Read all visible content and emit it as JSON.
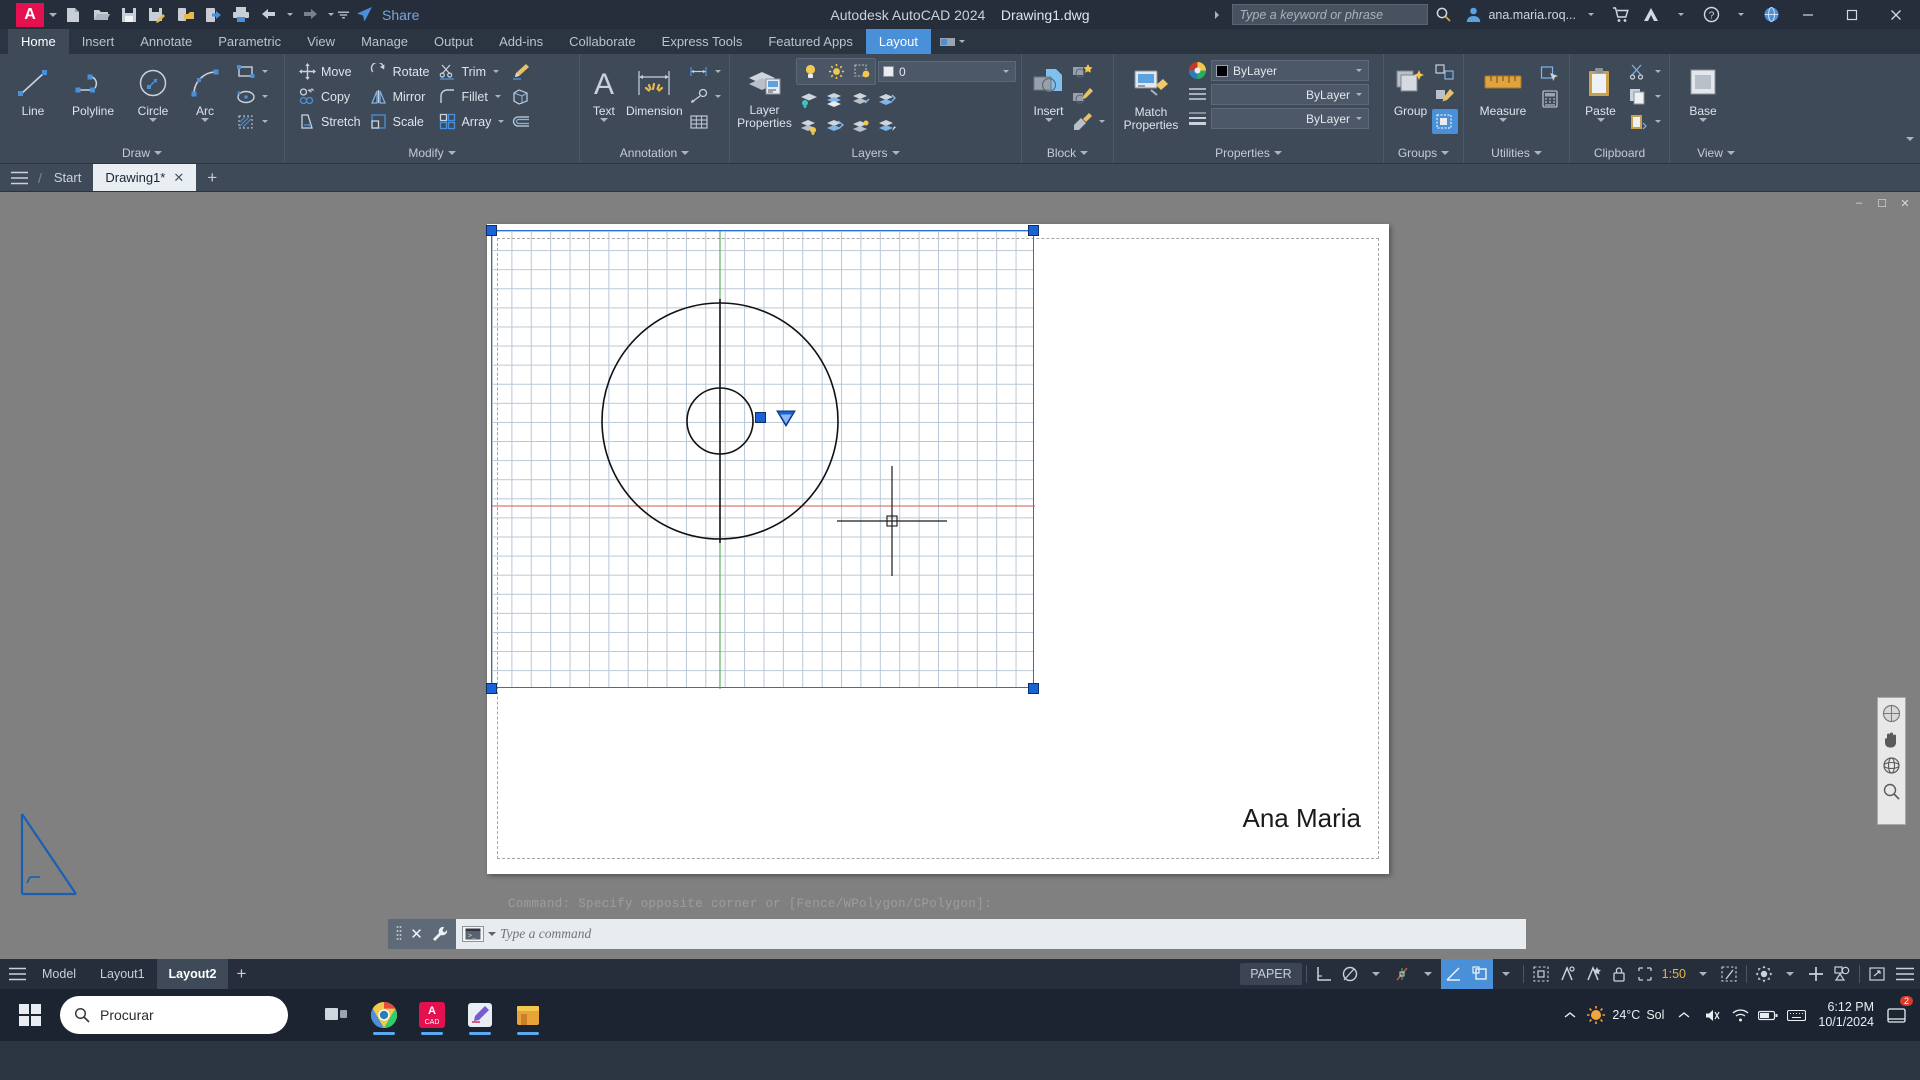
{
  "titlebar": {
    "app_logo": "A",
    "product": "Autodesk AutoCAD 2024",
    "filename": "Drawing1.dwg",
    "share_label": "Share",
    "search_placeholder": "Type a keyword or phrase",
    "user": "ana.maria.roq...",
    "qat": [
      {
        "name": "new-file-icon",
        "title": "New"
      },
      {
        "name": "open-file-icon",
        "title": "Open"
      },
      {
        "name": "save-icon",
        "title": "Save"
      },
      {
        "name": "save-as-icon",
        "title": "Save As"
      },
      {
        "name": "save-to-web-icon",
        "title": "Save to Web & Mobile"
      },
      {
        "name": "open-from-web-icon",
        "title": "Open from Web & Mobile"
      },
      {
        "name": "plot-icon",
        "title": "Plot"
      },
      {
        "name": "undo-icon",
        "title": "Undo"
      },
      {
        "name": "redo-icon",
        "title": "Redo"
      }
    ],
    "window_buttons": [
      "minimize",
      "maximize",
      "close"
    ]
  },
  "ribbon_tabs": [
    {
      "label": "Home",
      "state": "active"
    },
    {
      "label": "Insert",
      "state": "normal"
    },
    {
      "label": "Annotate",
      "state": "normal"
    },
    {
      "label": "Parametric",
      "state": "normal"
    },
    {
      "label": "View",
      "state": "normal"
    },
    {
      "label": "Manage",
      "state": "normal"
    },
    {
      "label": "Output",
      "state": "normal"
    },
    {
      "label": "Add-ins",
      "state": "normal"
    },
    {
      "label": "Collaborate",
      "state": "normal"
    },
    {
      "label": "Express Tools",
      "state": "normal"
    },
    {
      "label": "Featured Apps",
      "state": "normal"
    },
    {
      "label": "Layout",
      "state": "highlight"
    }
  ],
  "ribbon": {
    "draw": {
      "title": "Draw",
      "big": [
        {
          "label": "Line",
          "icon": "line-icon",
          "has_arrow": false
        },
        {
          "label": "Polyline",
          "icon": "polyline-icon",
          "has_arrow": false
        },
        {
          "label": "Circle",
          "icon": "circle-icon",
          "has_arrow": true
        },
        {
          "label": "Arc",
          "icon": "arc-icon",
          "has_arrow": true
        }
      ],
      "small": [
        {
          "icon": "rectangle-icon",
          "has_arrow": true
        },
        {
          "icon": "ellipse-icon",
          "has_arrow": true
        },
        {
          "icon": "hatch-icon",
          "has_arrow": true
        }
      ]
    },
    "modify": {
      "title": "Modify",
      "col1": [
        {
          "label": "Move",
          "icon": "move-icon"
        },
        {
          "label": "Copy",
          "icon": "copy-icon"
        },
        {
          "label": "Stretch",
          "icon": "stretch-icon"
        }
      ],
      "col2": [
        {
          "label": "Rotate",
          "icon": "rotate-icon"
        },
        {
          "label": "Mirror",
          "icon": "mirror-icon"
        },
        {
          "label": "Scale",
          "icon": "scale-icon"
        }
      ],
      "col3": [
        {
          "label": "Trim",
          "icon": "trim-icon",
          "has_arrow": true
        },
        {
          "label": "Fillet",
          "icon": "fillet-icon",
          "has_arrow": true
        },
        {
          "label": "Array",
          "icon": "array-icon",
          "has_arrow": true
        }
      ],
      "col4": [
        {
          "icon": "erase-icon"
        },
        {
          "icon": "extrude-icon"
        },
        {
          "icon": "offset-icon"
        }
      ]
    },
    "annotation": {
      "title": "Annotation",
      "big": [
        {
          "label": "Text",
          "icon": "text-icon",
          "has_arrow": true
        },
        {
          "label": "Dimension",
          "icon": "dimension-icon",
          "has_arrow": false
        }
      ],
      "small": [
        {
          "icon": "linear-dimension-icon",
          "has_arrow": true
        },
        {
          "icon": "leader-icon",
          "has_arrow": true
        },
        {
          "icon": "table-icon",
          "has_arrow": false
        }
      ]
    },
    "layers": {
      "title": "Layers",
      "big": {
        "label": "Layer\nProperties",
        "icon": "layer-properties-icon"
      },
      "current_layer": "0",
      "toggles": [
        {
          "icon": "layer-onoff-icon"
        },
        {
          "icon": "layer-freeze-icon"
        },
        {
          "icon": "layer-lock-icon"
        }
      ],
      "grid_icons": [
        "layer-isolate-icon",
        "layer-freeze-obj-icon",
        "layer-off-obj-icon",
        "layer-make-current-icon",
        "layer-match-icon",
        "layer-previous-icon",
        "layer-unisolate-icon",
        "layer-turn-all-on-icon",
        "layer-thaw-all-icon"
      ]
    },
    "block": {
      "title": "Block",
      "big": {
        "label": "Insert",
        "icon": "insert-block-icon",
        "has_arrow": true
      },
      "small": [
        {
          "icon": "create-block-icon"
        },
        {
          "icon": "edit-block-icon"
        },
        {
          "icon": "edit-attribute-icon",
          "has_arrow": true
        }
      ]
    },
    "properties": {
      "title": "Properties",
      "big": {
        "label": "Match\nProperties",
        "icon": "match-properties-icon"
      },
      "rows": [
        {
          "icon": "color-wheel-icon",
          "value": "ByLayer",
          "swatch": "#000000",
          "type": "color"
        },
        {
          "icon": "linetype-icon",
          "value": "ByLayer",
          "type": "linetype"
        },
        {
          "icon": "lineweight-icon",
          "value": "ByLayer",
          "type": "lineweight"
        }
      ]
    },
    "groups": {
      "title": "Groups",
      "big": {
        "label": "Group",
        "icon": "group-icon"
      },
      "small": [
        {
          "icon": "ungroup-icon"
        },
        {
          "icon": "group-edit-icon"
        },
        {
          "icon": "group-selection-on-icon",
          "active": true
        }
      ]
    },
    "utilities": {
      "title": "Utilities",
      "big": {
        "label": "Measure",
        "icon": "measure-icon",
        "has_arrow": true
      },
      "small": [
        {
          "icon": "quick-select-icon"
        },
        {
          "icon": "quick-calc-icon"
        }
      ]
    },
    "clipboard": {
      "title": "Clipboard",
      "big": {
        "label": "Paste",
        "icon": "paste-icon",
        "has_arrow": true
      },
      "small": [
        {
          "icon": "cut-icon"
        },
        {
          "icon": "copy-clip-icon"
        },
        {
          "icon": "paste-special-icon"
        }
      ]
    },
    "view": {
      "title": "View",
      "big": {
        "label": "Base",
        "icon": "base-view-icon",
        "has_arrow": true
      }
    }
  },
  "doctabs": {
    "start_label": "Start",
    "tabs": [
      {
        "label": "Drawing1*",
        "active": true,
        "closable": true
      }
    ],
    "add_label": "+"
  },
  "canvas": {
    "command_echo": "Command: Specify opposite corner or [Fence/WPolygon/CPolygon]:",
    "paper_text": "Ana Maria",
    "viewport_selected": true,
    "mini_controls": [
      "minimize-viewport-icon",
      "restore-viewport-icon",
      "close-viewport-icon"
    ],
    "navbar_icons": [
      "full-navigation-wheel-icon",
      "pan-icon",
      "orbit-icon",
      "zoom-extents-icon"
    ]
  },
  "commandline": {
    "placeholder": "Type a command",
    "close_label": "✕",
    "tools_icon": "wrench-icon",
    "prompt_icon": "command-prompt-icon"
  },
  "statusbar": {
    "menu_icon": "status-menu-icon",
    "layout_tabs": [
      {
        "label": "Model",
        "active": false
      },
      {
        "label": "Layout1",
        "active": false
      },
      {
        "label": "Layout2",
        "active": true
      }
    ],
    "add_layout": "+",
    "space_label": "PAPER",
    "scale": "1:50",
    "toggles": [
      {
        "name": "ortho-icon",
        "on": false
      },
      {
        "name": "polar-tracking-icon",
        "on": false
      },
      {
        "name": "osnap-icon",
        "on": false
      },
      {
        "name": "otrack-icon",
        "on": true
      },
      {
        "name": "lineweight-display-icon",
        "on": true
      },
      {
        "name": "annotation-visibility-icon",
        "on": false
      },
      {
        "name": "autoscale-icon",
        "on": false
      },
      {
        "name": "annotation-scale-lock-icon",
        "on": false
      },
      {
        "name": "viewport-lock-icon",
        "on": false
      },
      {
        "name": "viewport-maximize-icon",
        "on": false
      },
      {
        "name": "customization-icon",
        "on": false
      },
      {
        "name": "isolate-objects-icon",
        "on": false
      },
      {
        "name": "clean-screen-icon",
        "on": false
      }
    ]
  },
  "taskbar": {
    "search_placeholder": "Procurar",
    "apps": [
      {
        "name": "taskview-icon",
        "running": false
      },
      {
        "name": "chrome-icon",
        "running": true
      },
      {
        "name": "autocad-icon",
        "running": true
      },
      {
        "name": "paint-icon",
        "running": true
      },
      {
        "name": "store-icon",
        "running": true
      }
    ],
    "weather": {
      "temp": "24°C",
      "condition": "Sol"
    },
    "clock": {
      "time": "6:12 PM",
      "date": "10/1/2024"
    },
    "notification_count": "2",
    "tray": [
      "show-hidden-icons-icon",
      "volume-icon",
      "network-icon",
      "battery-icon",
      "keyboard-icon"
    ]
  }
}
